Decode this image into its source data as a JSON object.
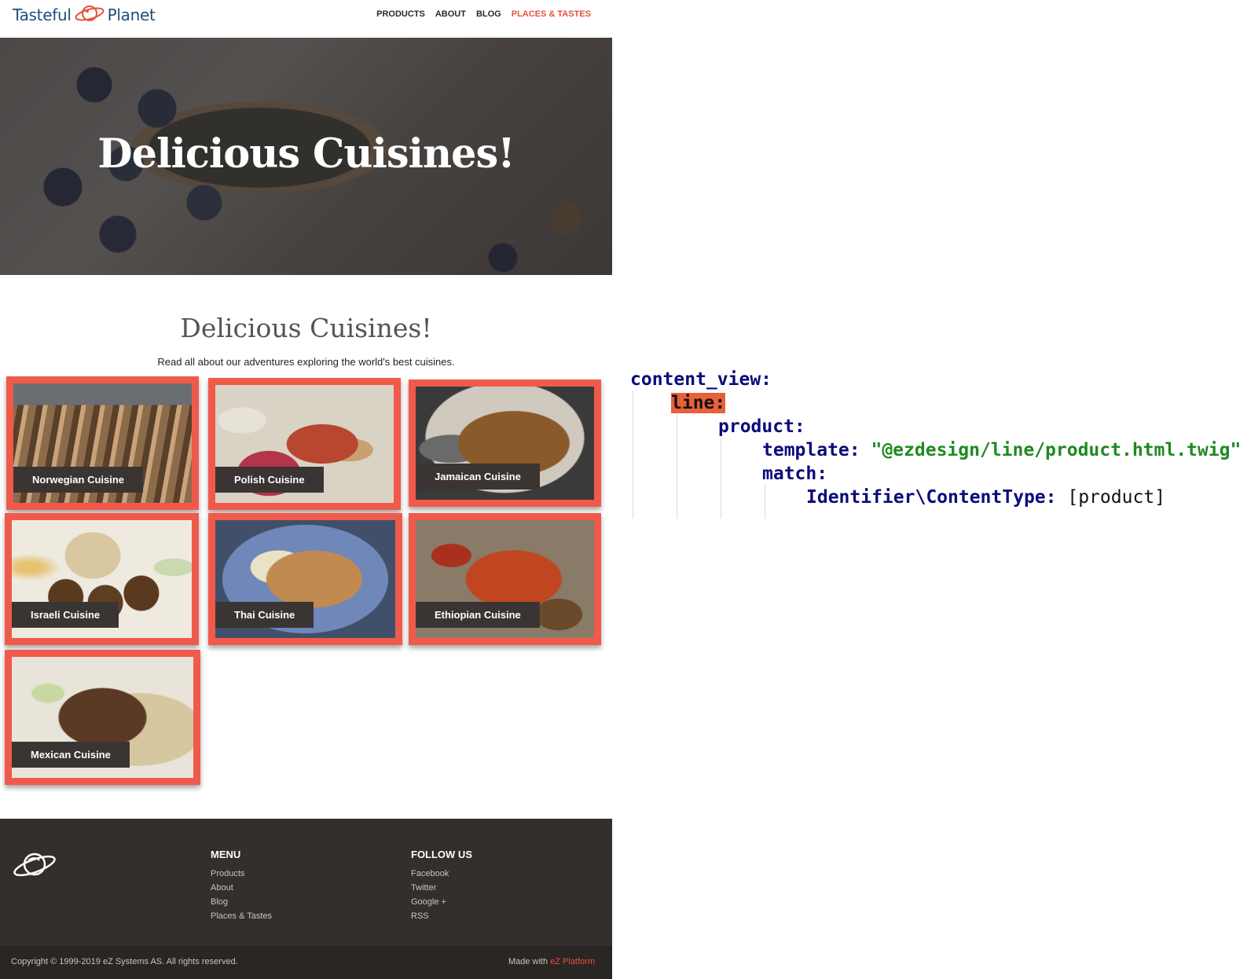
{
  "header": {
    "logo_left": "Tasteful",
    "logo_right": "Planet",
    "nav": [
      "PRODUCTS",
      "ABOUT",
      "BLOG",
      "PLACES & TASTES"
    ],
    "active_nav": "PLACES & TASTES",
    "accent_color": "#e8513b"
  },
  "hero": {
    "title": "Delicious Cuisines!"
  },
  "section": {
    "title": "Delicious Cuisines!",
    "subtitle": "Read all about our adventures exploring the world's best cuisines."
  },
  "cards": [
    {
      "label": "Norwegian Cuisine"
    },
    {
      "label": "Polish Cuisine"
    },
    {
      "label": "Jamaican Cuisine"
    },
    {
      "label": "Israeli Cuisine"
    },
    {
      "label": "Thai Cuisine"
    },
    {
      "label": "Ethiopian Cuisine"
    },
    {
      "label": "Mexican Cuisine"
    }
  ],
  "footer": {
    "logo_icon": "planet-icon",
    "menu_heading": "MENU",
    "menu_links": [
      "Products",
      "About",
      "Blog",
      "Places & Tastes"
    ],
    "follow_heading": "FOLLOW US",
    "follow_links": [
      "Facebook",
      "Twitter",
      "Google +",
      "RSS"
    ],
    "copyright": "Copyright © 1999-2019 eZ Systems AS. All rights reserved.",
    "made_with": "Made with",
    "platform": "eZ Platform"
  },
  "code": {
    "l1": "content_view:",
    "l2": "line:",
    "l3": "product:",
    "l4_key": "template:",
    "l4_val": "\"@ezdesign/line/product.html.twig\"",
    "l5": "match:",
    "l6_key": "Identifier\\ContentType:",
    "l6_val": "[product]",
    "highlight_color": "#e8603a"
  }
}
